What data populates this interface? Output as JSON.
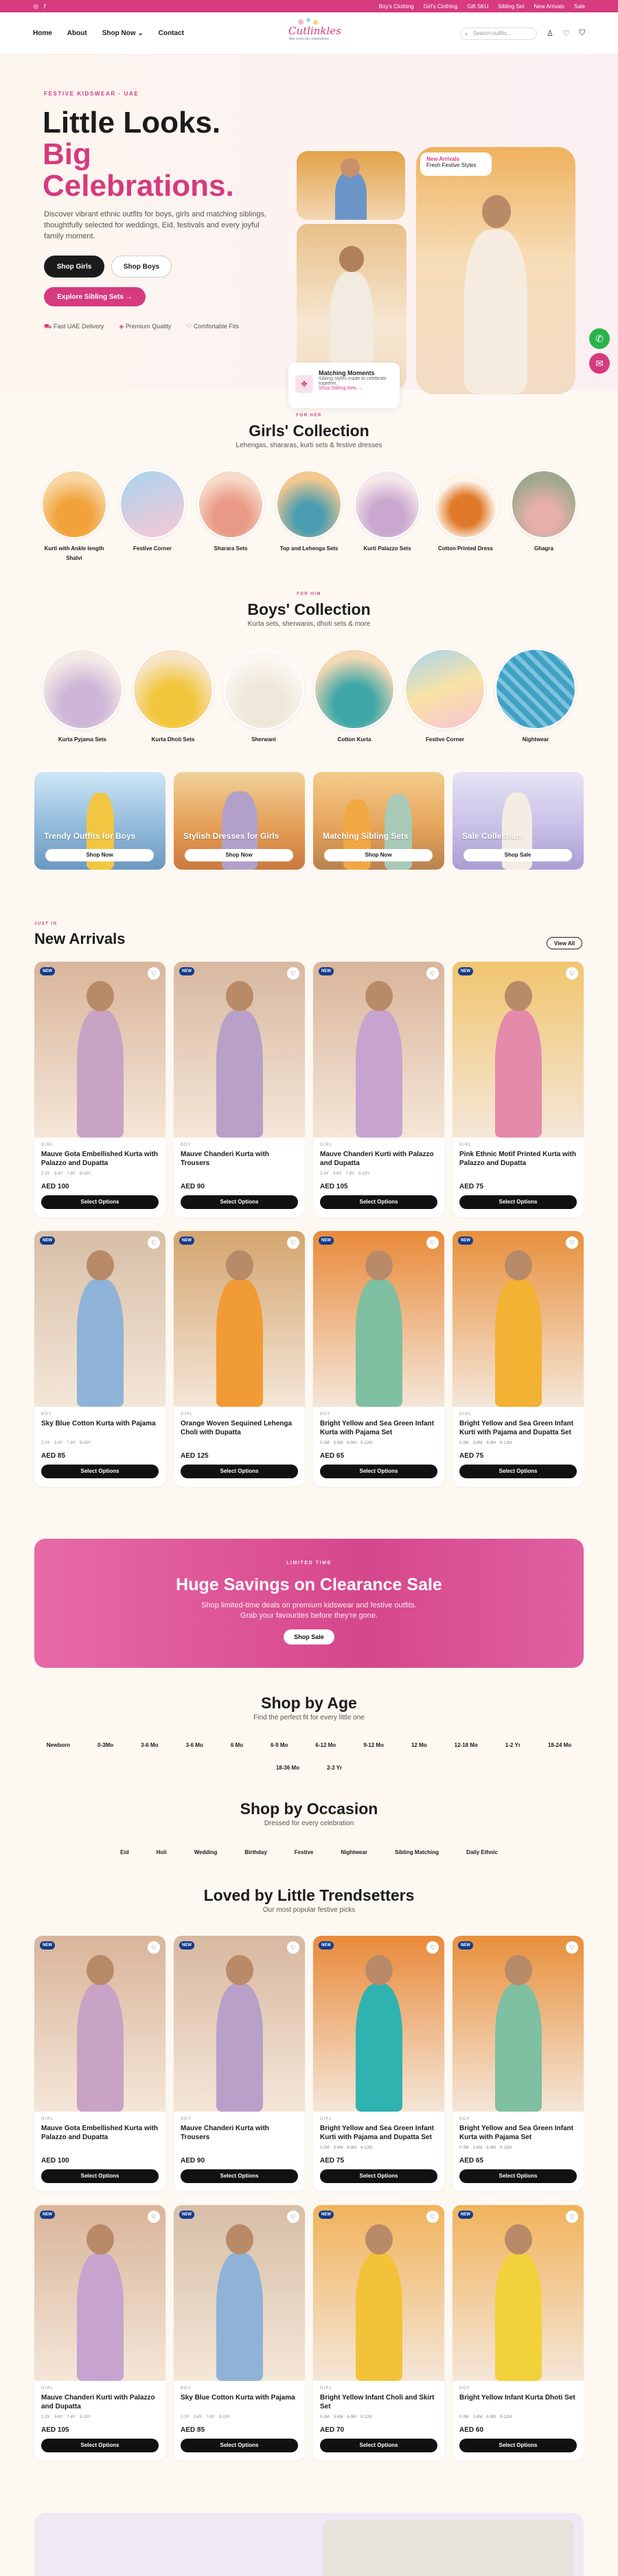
{
  "topbar": {
    "social": [
      "◎",
      "f"
    ],
    "links": [
      "Boy's Clothing",
      "Girl's Clothing",
      "Gift SKU",
      "Sibling Set",
      "New Arrivals",
      "Sale"
    ]
  },
  "nav": {
    "home": "Home",
    "about": "About",
    "shop": "Shop Now ⌄",
    "contact": "Contact"
  },
  "logo": {
    "text": "Cutlinkles",
    "tag": "little looks big celebrations"
  },
  "search": {
    "placeholder": "Search outfits..."
  },
  "hero": {
    "eyebrow": "FESTIVE KIDSWEAR · UAE",
    "line1": "Little Looks.",
    "line2": "Big",
    "line3": "Celebrations.",
    "desc": "Discover vibrant ethnic outfits for boys, girls and matching siblings, thoughtfully selected for weddings, Eid, festivals and every joyful family moment.",
    "btn_girls": "Shop Girls",
    "btn_boys": "Shop Boys",
    "btn_sib": "Explore Sibling Sets  →",
    "badges": [
      "Fast UAE Delivery",
      "Premium Quality",
      "Comfortable Fits"
    ],
    "new_tag_title": "New Arrivals",
    "new_tag_sub": "Fresh Festive Styles",
    "match_title": "Matching Moments",
    "match_desc": "Sibling styles made to celebrate together.",
    "match_link": "Shop Sibling Sets →"
  },
  "girls": {
    "eyebrow": "FOR HER",
    "title": "Girls' Collection",
    "sub": "Lehengas, shararas, kurti sets & festive dresses",
    "items": [
      "Kurti with Ankle length Shalvi",
      "Festive Corner",
      "Sharara Sets",
      "Top and Lehenga Sets",
      "Kurti Palazzo Sets",
      "Cotton Printed Dress",
      "Ghagra"
    ]
  },
  "boys": {
    "eyebrow": "FOR HIM",
    "title": "Boys' Collection",
    "sub": "Kurta sets, sherwanis, dhoti sets & more",
    "items": [
      "Kurta Pyjama Sets",
      "Kurta Dhoti Sets",
      "Sherwani",
      "Cotton Kurta",
      "Festive Corner",
      "Nightwear"
    ]
  },
  "tiles": [
    {
      "label": "Trendy Outfits for Boys",
      "btn": "Shop Now"
    },
    {
      "label": "Stylish Dresses for Girls",
      "btn": "Shop Now"
    },
    {
      "label": "Matching Sibling Sets",
      "btn": "Shop Now"
    },
    {
      "label": "Sale Collection",
      "btn": "Shop Sale"
    }
  ],
  "arrivals": {
    "eyebrow": "JUST IN",
    "title": "New Arrivals",
    "view_all": "View All",
    "products": [
      {
        "brand": "GIRL",
        "name": "Mauve Gota Embellished Kurta with Palazzo and Dupatta",
        "sizes": [
          "2-3Y",
          "3-4Y",
          "7-8Y",
          "9-10Y"
        ],
        "price": "AED 100",
        "btn": "Select Options"
      },
      {
        "brand": "BOY",
        "name": "Mauve Chanderi Kurta with Trousers",
        "sizes": [
          "",
          "",
          "",
          ""
        ],
        "price": "AED 90",
        "btn": "Select Options"
      },
      {
        "brand": "GIRL",
        "name": "Mauve Chanderi Kurti with Palazzo and Dupatta",
        "sizes": [
          "2-3Y",
          "3-4Y",
          "7-8Y",
          "9-10Y"
        ],
        "price": "AED 105",
        "btn": "Select Options"
      },
      {
        "brand": "GIRL",
        "name": "Pink Ethnic Motif Printed Kurta with Palazzo and Dupatta",
        "sizes": [
          "",
          "",
          "",
          ""
        ],
        "price": "AED 75",
        "btn": "Select Options"
      },
      {
        "brand": "BOY",
        "name": "Sky Blue Cotton Kurta with Pajama",
        "sizes": [
          "2-3Y",
          "3-4Y",
          "7-8Y",
          "9-10Y"
        ],
        "price": "AED 85",
        "btn": "Select Options"
      },
      {
        "brand": "GIRL",
        "name": "Orange Woven Sequined Lehenga Choli with Dupatta",
        "sizes": [
          "",
          "",
          "",
          ""
        ],
        "price": "AED 125",
        "btn": "Select Options"
      },
      {
        "brand": "BOY",
        "name": "Bright Yellow and Sea Green Infant Kurta with Pajama Set",
        "sizes": [
          "0-3M",
          "3-6M",
          "6-9M",
          "9-12M"
        ],
        "price": "AED 65",
        "btn": "Select Options"
      },
      {
        "brand": "GIRL",
        "name": "Bright Yellow and Sea Green Infant Kurti with Pajama and Dupatta Set",
        "sizes": [
          "0-3M",
          "3-6M",
          "6-9M",
          "9-12M"
        ],
        "price": "AED 75",
        "btn": "Select Options"
      }
    ]
  },
  "sale": {
    "label": "LIMITED TIME",
    "title": "Huge Savings on Clearance Sale",
    "desc": "Shop limited-time deals on premium kidswear and festive outfits. Grab your favourites before they're gone.",
    "btn": "Shop Sale"
  },
  "age": {
    "title": "Shop by Age",
    "sub": "Find the perfect fit for every little one",
    "items": [
      "Newborn",
      "0-3Mo",
      "3-6 Mo",
      "3-6 Mo",
      "6 Mo",
      "6-9 Mo",
      "6-12 Mo",
      "9-12 Mo",
      "12 Mo",
      "12-18 Mo",
      "1-2 Yr",
      "18-24 Mo",
      "18-36 Mo",
      "2-3 Yr"
    ]
  },
  "occasion": {
    "title": "Shop by Occasion",
    "sub": "Dressed for every celebration",
    "items": [
      "Eid",
      "Holi",
      "Wedding",
      "Birthday",
      "Festive",
      "Nightwear",
      "Sibling Matching",
      "Daily Ethnic"
    ]
  },
  "loved": {
    "title": "Loved by Little Trendsetters",
    "sub": "Our most popular festive picks",
    "products": [
      {
        "brand": "GIRL",
        "name": "Mauve Gota Embellished Kurta with Palazzo and Dupatta",
        "sizes": [
          "",
          "",
          "",
          ""
        ],
        "price": "AED 100",
        "btn": "Select Options"
      },
      {
        "brand": "BOY",
        "name": "Mauve Chanderi Kurta with Trousers",
        "sizes": [
          "",
          "",
          "",
          ""
        ],
        "price": "AED 90",
        "btn": "Select Options"
      },
      {
        "brand": "GIRL",
        "name": "Bright Yellow and Sea Green Infant Kurti with Pajama and Dupatta Set",
        "sizes": [
          "0-3M",
          "3-6M",
          "6-9M",
          "9-12M"
        ],
        "price": "AED 75",
        "btn": "Select Options"
      },
      {
        "brand": "BOY",
        "name": "Bright Yellow and Sea Green Infant Kurta with Pajama Set",
        "sizes": [
          "0-3M",
          "3-6M",
          "6-9M",
          "9-12M"
        ],
        "price": "AED 65",
        "btn": "Select Options"
      },
      {
        "brand": "GIRL",
        "name": "Mauve Chanderi Kurti with Palazzo and Dupatta",
        "sizes": [
          "2-3Y",
          "3-4Y",
          "7-8Y",
          "9-10Y"
        ],
        "price": "AED 105",
        "btn": "Select Options"
      },
      {
        "brand": "BOY",
        "name": "Sky Blue Cotton Kurta with Pajama",
        "sizes": [
          "2-3Y",
          "3-4Y",
          "7-8Y",
          "9-10Y"
        ],
        "price": "AED 85",
        "btn": "Select Options"
      },
      {
        "brand": "GIRL",
        "name": "Bright Yellow Infant Choli and Skirt Set",
        "sizes": [
          "0-3M",
          "3-6M",
          "6-9M",
          "9-12M"
        ],
        "price": "AED 70",
        "btn": "Select Options"
      },
      {
        "brand": "BOY",
        "name": "Bright Yellow Infant Kurta Dhoti Set",
        "sizes": [
          "0-3M",
          "3-6M",
          "6-9M",
          "9-12M"
        ],
        "price": "AED 60",
        "btn": "Select Options"
      }
    ]
  },
  "colors": {
    "accent": "#d63a7f",
    "dark": "#1b1b1b",
    "cream": "#fdf8f2"
  }
}
